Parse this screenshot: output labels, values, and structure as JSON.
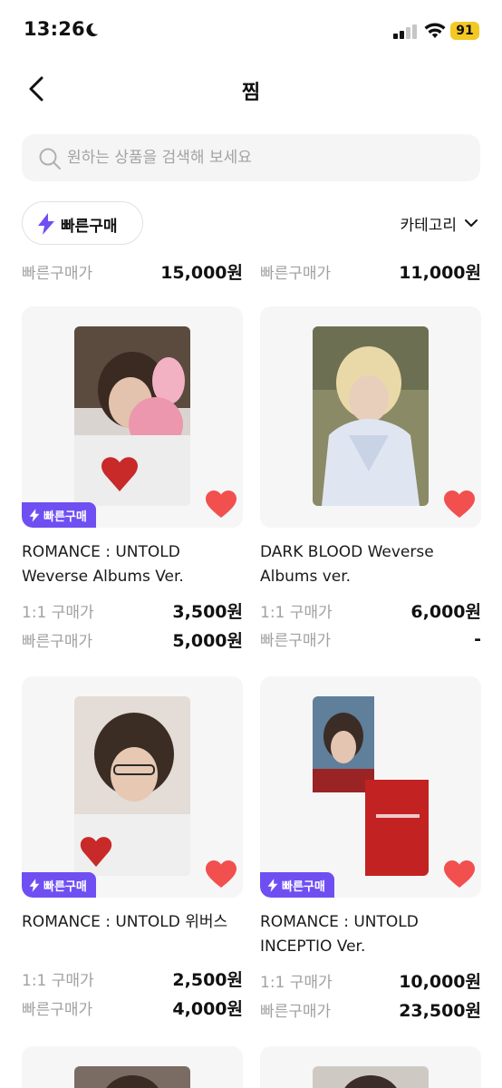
{
  "status": {
    "time": "13:26",
    "battery": "91"
  },
  "nav": {
    "title": "찜"
  },
  "search": {
    "placeholder": "원하는 상품을 검색해 보세요"
  },
  "filter": {
    "quick_buy_label": "빠른구매",
    "category_label": "카테고리"
  },
  "labels": {
    "one_to_one": "1:1 구매가",
    "quick_buy": "빠른구매가",
    "badge": "빠른구매"
  },
  "top_prices": [
    {
      "label": "빠른구매가",
      "value": "15,000원"
    },
    {
      "label": "빠른구매가",
      "value": "11,000원"
    }
  ],
  "products": [
    {
      "title": "ROMANCE : UNTOLD Weverse Albums Ver.",
      "price_1to1": "3,500원",
      "price_quick": "5,000원",
      "quick_badge": true,
      "liked": true
    },
    {
      "title": "DARK BLOOD Weverse Albums ver.",
      "price_1to1": "6,000원",
      "price_quick": "-",
      "quick_badge": false,
      "liked": true
    },
    {
      "title": "ROMANCE : UNTOLD 위버스",
      "price_1to1": "2,500원",
      "price_quick": "4,000원",
      "quick_badge": true,
      "liked": true
    },
    {
      "title": "ROMANCE : UNTOLD INCEPTIO Ver.",
      "price_1to1": "10,000원",
      "price_quick": "23,500원",
      "quick_badge": true,
      "liked": true
    }
  ],
  "colors": {
    "accent": "#6f4ff2",
    "heart": "#f24f4f",
    "badge_text": "#ffffff",
    "muted": "#a1a1a1"
  },
  "icons": {
    "back": "chevron-left-icon",
    "search": "search-icon",
    "bolt": "lightning-icon",
    "heart": "heart-icon",
    "chevron": "chevron-down-icon"
  }
}
